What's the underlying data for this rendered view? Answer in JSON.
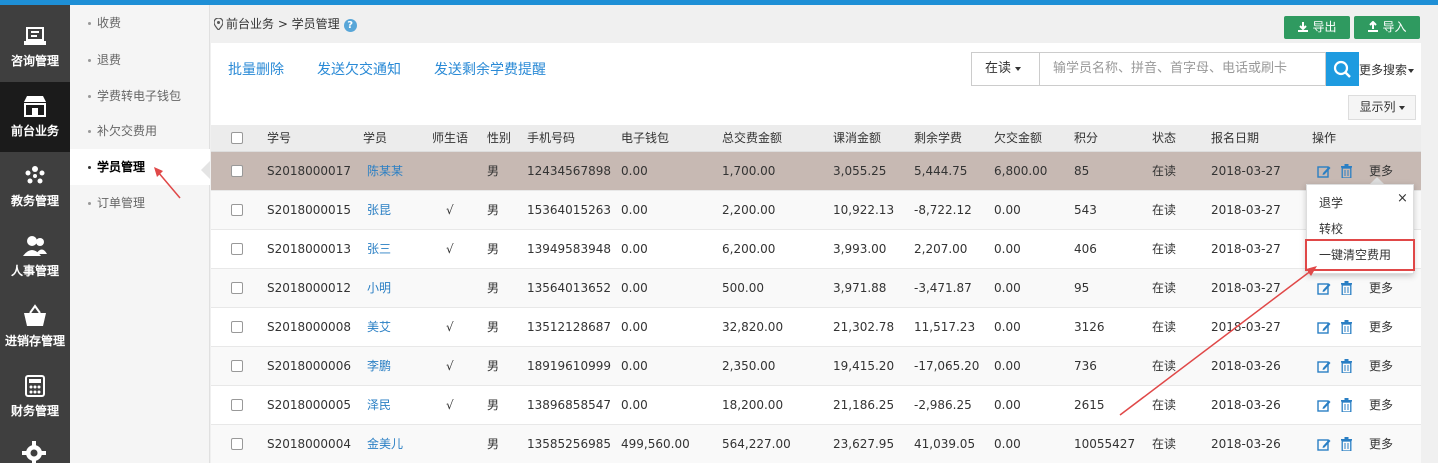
{
  "nav": {
    "items": [
      {
        "label": "咨询管理",
        "icon": "consult-icon"
      },
      {
        "label": "前台业务",
        "icon": "storefront-icon"
      },
      {
        "label": "教务管理",
        "icon": "group-icon"
      },
      {
        "label": "人事管理",
        "icon": "people-icon"
      },
      {
        "label": "进销存管理",
        "icon": "basket-icon"
      },
      {
        "label": "财务管理",
        "icon": "calculator-icon"
      }
    ]
  },
  "submenu": {
    "items": [
      "收费",
      "退费",
      "学费转电子钱包",
      "补欠交费用",
      "学员管理",
      "订单管理"
    ],
    "active": "学员管理"
  },
  "breadcrumb": {
    "path": "前台业务 > 学员管理"
  },
  "header": {
    "export_label": "导出",
    "import_label": "导入"
  },
  "actions": {
    "batch_delete": "批量删除",
    "send_arrears": "发送欠交通知",
    "send_remaining": "发送剩余学费提醒"
  },
  "search": {
    "status": "在读",
    "placeholder": "输学员名称、拼音、首字母、电话或刷卡",
    "more": "更多搜索"
  },
  "display_columns": "显示列",
  "table": {
    "headers": [
      "学号",
      "学员",
      "师生语",
      "性别",
      "手机号码",
      "电子钱包",
      "总交费金额",
      "课消金额",
      "剩余学费",
      "欠交金额",
      "积分",
      "状态",
      "报名日期",
      "操作"
    ],
    "more_label": "更多",
    "rows": [
      {
        "id": "S2018000017",
        "name": "陈某某",
        "tag": "",
        "gender": "男",
        "phone": "12434567898",
        "wallet": "0.00",
        "total": "1,700.00",
        "consumed": "3,055.25",
        "remaining": "5,444.75",
        "owed": "6,800.00",
        "points": "85",
        "status": "在读",
        "date": "2018-03-27"
      },
      {
        "id": "S2018000015",
        "name": "张昆",
        "tag": "√",
        "gender": "男",
        "phone": "15364015263",
        "wallet": "0.00",
        "total": "2,200.00",
        "consumed": "10,922.13",
        "remaining": "-8,722.12",
        "owed": "0.00",
        "points": "543",
        "status": "在读",
        "date": "2018-03-27"
      },
      {
        "id": "S2018000013",
        "name": "张三",
        "tag": "√",
        "gender": "男",
        "phone": "13949583948",
        "wallet": "0.00",
        "total": "6,200.00",
        "consumed": "3,993.00",
        "remaining": "2,207.00",
        "owed": "0.00",
        "points": "406",
        "status": "在读",
        "date": "2018-03-27"
      },
      {
        "id": "S2018000012",
        "name": "小明",
        "tag": "",
        "gender": "男",
        "phone": "13564013652",
        "wallet": "0.00",
        "total": "500.00",
        "consumed": "3,971.88",
        "remaining": "-3,471.87",
        "owed": "0.00",
        "points": "95",
        "status": "在读",
        "date": "2018-03-27"
      },
      {
        "id": "S2018000008",
        "name": "美艾",
        "tag": "√",
        "gender": "男",
        "phone": "13512128687",
        "wallet": "0.00",
        "total": "32,820.00",
        "consumed": "21,302.78",
        "remaining": "11,517.23",
        "owed": "0.00",
        "points": "3126",
        "status": "在读",
        "date": "2018-03-27"
      },
      {
        "id": "S2018000006",
        "name": "李鹏",
        "tag": "√",
        "gender": "男",
        "phone": "18919610999",
        "wallet": "0.00",
        "total": "2,350.00",
        "consumed": "19,415.20",
        "remaining": "-17,065.20",
        "owed": "0.00",
        "points": "736",
        "status": "在读",
        "date": "2018-03-26"
      },
      {
        "id": "S2018000005",
        "name": "泽民",
        "tag": "√",
        "gender": "男",
        "phone": "13896858547",
        "wallet": "0.00",
        "total": "18,200.00",
        "consumed": "21,186.25",
        "remaining": "-2,986.25",
        "owed": "0.00",
        "points": "2615",
        "status": "在读",
        "date": "2018-03-26"
      },
      {
        "id": "S2018000004",
        "name": "金美儿",
        "tag": "",
        "gender": "男",
        "phone": "13585256985",
        "wallet": "499,560.00",
        "total": "564,227.00",
        "consumed": "23,627.95",
        "remaining": "41,039.05",
        "owed": "0.00",
        "points": "10055427",
        "status": "在读",
        "date": "2018-03-26"
      }
    ]
  },
  "popup": {
    "items": [
      "退学",
      "转校",
      "一键清空费用"
    ],
    "close": "×"
  },
  "colors": {
    "accent": "#1e9be0",
    "link": "#2a7fc4",
    "green": "#2f9a60",
    "annotation": "#e04848",
    "selected_row": "#c7b9b3"
  }
}
